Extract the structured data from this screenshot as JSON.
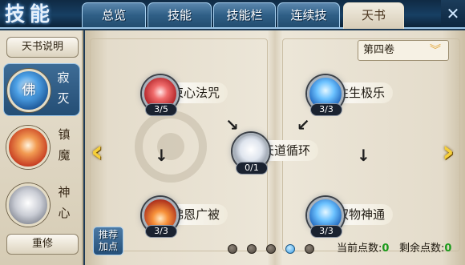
{
  "header": {
    "title": "技能",
    "tabs": [
      {
        "label": "总览",
        "active": false
      },
      {
        "label": "技能",
        "active": false
      },
      {
        "label": "技能栏",
        "active": false
      },
      {
        "label": "连续技",
        "active": false
      },
      {
        "label": "天书",
        "active": true
      }
    ],
    "close_icon": "close-x-icon"
  },
  "sidebar": {
    "top_button": "天书说明",
    "books": [
      {
        "glyph": "佛",
        "name": "寂灭",
        "active": true,
        "orb": "blue"
      },
      {
        "glyph": "",
        "name": "镇魔",
        "active": false,
        "orb": "red"
      },
      {
        "glyph": "",
        "name": "神心",
        "active": false,
        "orb": "white"
      }
    ],
    "bottom_button": "重修"
  },
  "main": {
    "volume_select": {
      "value": "第四卷",
      "icon": "chevron-down-icon"
    },
    "skills": [
      {
        "name": "束心法咒",
        "level": "3/5",
        "icon": "red"
      },
      {
        "name": "往生极乐",
        "level": "3/3",
        "icon": "blue"
      },
      {
        "name": "天道循环",
        "level": "0/1",
        "icon": "white"
      },
      {
        "name": "佛恩广被",
        "level": "3/3",
        "icon": "redfire"
      },
      {
        "name": "驭物神通",
        "level": "3/3",
        "icon": "blue"
      }
    ],
    "recommend_button": [
      "推荐",
      "加点"
    ],
    "pagination": {
      "total": 5,
      "current": 4
    },
    "current_points_label": "当前点数:",
    "current_points": "0",
    "remaining_points_label": "剩余点数:",
    "remaining_points": "0"
  },
  "colors": {
    "accent_yellow": "#f5cf3a",
    "tab_blue": "#2f5f86",
    "parchment": "#ece6d8"
  }
}
